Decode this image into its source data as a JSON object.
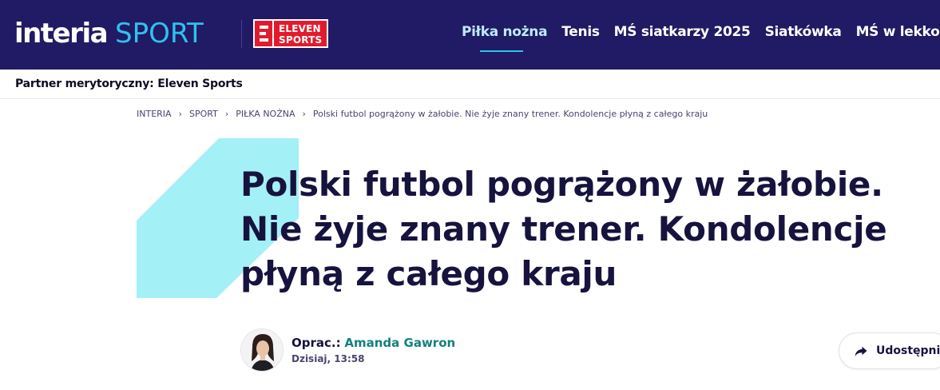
{
  "header": {
    "logo_main": "interia",
    "logo_section": "SPORT",
    "partner_logo_line1": "ELEVEN",
    "partner_logo_line2": "SPORTS",
    "nav": [
      {
        "label": "Piłka nożna",
        "active": true
      },
      {
        "label": "Tenis",
        "active": false
      },
      {
        "label": "MŚ siatkarzy 2025",
        "active": false
      },
      {
        "label": "Siatkówka",
        "active": false
      },
      {
        "label": "MŚ w lekkoatletyce",
        "active": false
      }
    ]
  },
  "partner_bar": {
    "text": "Partner merytoryczny: Eleven Sports"
  },
  "breadcrumb": {
    "items": [
      "INTERIA",
      "SPORT",
      "PIŁKA NOŻNA"
    ],
    "separator": "›",
    "current": "Polski futbol pogrążony w żałobie. Nie żyje znany trener. Kondolencje płyną z całego kraju"
  },
  "article": {
    "title": "Polski futbol pogrążony w żałobie. Nie żyje znany trener. Kondolencje płyną z całego kraju",
    "author_prefix": "Oprac.:",
    "author_name": "Amanda Gawron",
    "published": "Dzisiaj, 13:58",
    "share_label": "Udostępnij"
  },
  "colors": {
    "header_bg": "#211a64",
    "accent_cyan": "#2ec2ee",
    "deco_shape": "#a4f0f7",
    "title_text": "#16133e",
    "author_link": "#13817f",
    "brand_red": "#e21b2c"
  },
  "icons": {
    "share": "share-arrow-icon",
    "avatar": "author-avatar"
  }
}
